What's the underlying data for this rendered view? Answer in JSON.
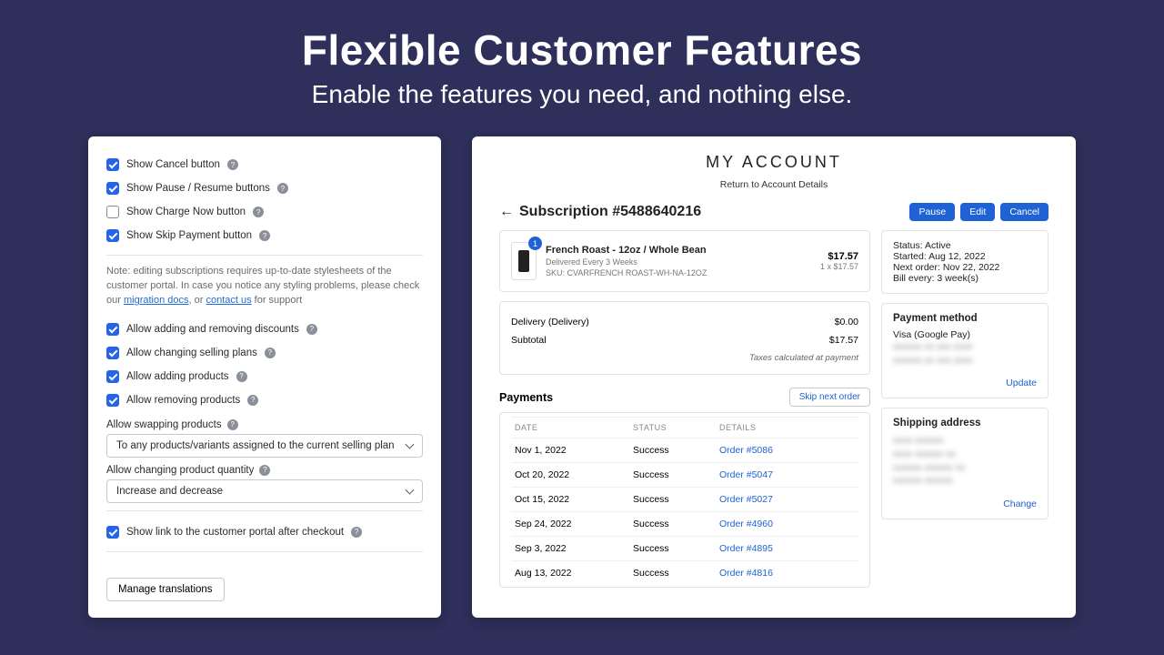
{
  "hero": {
    "title": "Flexible Customer Features",
    "subtitle": "Enable the features you need, and nothing else."
  },
  "settings": {
    "show_cancel": {
      "label": "Show Cancel button",
      "checked": true
    },
    "show_pause": {
      "label": "Show Pause / Resume buttons",
      "checked": true
    },
    "show_charge_now": {
      "label": "Show Charge Now button",
      "checked": false
    },
    "show_skip_payment": {
      "label": "Show Skip Payment button",
      "checked": true
    },
    "note_pre": "Note: editing subscriptions requires up-to-date stylesheets of the customer portal. In case you notice any styling problems, please check our ",
    "note_link1": "migration docs",
    "note_mid": ", or ",
    "note_link2": "contact us",
    "note_post": " for support",
    "allow_discounts": {
      "label": "Allow adding and removing discounts",
      "checked": true
    },
    "allow_plans": {
      "label": "Allow changing selling plans",
      "checked": true
    },
    "allow_add_products": {
      "label": "Allow adding products",
      "checked": true
    },
    "allow_remove_products": {
      "label": "Allow removing products",
      "checked": true
    },
    "swap_label": "Allow swapping products",
    "swap_value": "To any products/variants assigned to the current selling plan",
    "qty_label": "Allow changing product quantity",
    "qty_value": "Increase and decrease",
    "show_portal_link": {
      "label": "Show link to the customer portal after checkout",
      "checked": true
    },
    "manage_translations": "Manage translations"
  },
  "portal": {
    "title": "MY ACCOUNT",
    "return_link": "Return to Account Details",
    "subscription_title": "Subscription #5488640216",
    "actions": {
      "pause": "Pause",
      "edit": "Edit",
      "cancel": "Cancel"
    },
    "product": {
      "badge": "1",
      "name": "French Roast - 12oz / Whole Bean",
      "delivered": "Delivered Every 3 Weeks",
      "sku": "SKU: CVARFRENCH ROAST-WH-NA-12OZ",
      "price": "$17.57",
      "qty_price": "1 x $17.57"
    },
    "totals": {
      "delivery_label": "Delivery (Delivery)",
      "delivery_value": "$0.00",
      "subtotal_label": "Subtotal",
      "subtotal_value": "$17.57",
      "tax_note": "Taxes calculated at payment"
    },
    "payments": {
      "heading": "Payments",
      "skip_label": "Skip next order",
      "cols": {
        "date": "DATE",
        "status": "STATUS",
        "details": "DETAILS"
      },
      "rows": [
        {
          "date": "Nov 1, 2022",
          "status": "Success",
          "order": "Order #5086"
        },
        {
          "date": "Oct 20, 2022",
          "status": "Success",
          "order": "Order #5047"
        },
        {
          "date": "Oct 15, 2022",
          "status": "Success",
          "order": "Order #5027"
        },
        {
          "date": "Sep 24, 2022",
          "status": "Success",
          "order": "Order #4960"
        },
        {
          "date": "Sep 3, 2022",
          "status": "Success",
          "order": "Order #4895"
        },
        {
          "date": "Aug 13, 2022",
          "status": "Success",
          "order": "Order #4816"
        }
      ]
    },
    "status_box": {
      "status": "Status: Active",
      "started": "Started: Aug 12, 2022",
      "next": "Next order: Nov 22, 2022",
      "bill": "Bill every: 3 week(s)"
    },
    "payment_method": {
      "title": "Payment method",
      "line1": "Visa (Google Pay)",
      "update": "Update"
    },
    "shipping": {
      "title": "Shipping address",
      "change": "Change"
    }
  }
}
